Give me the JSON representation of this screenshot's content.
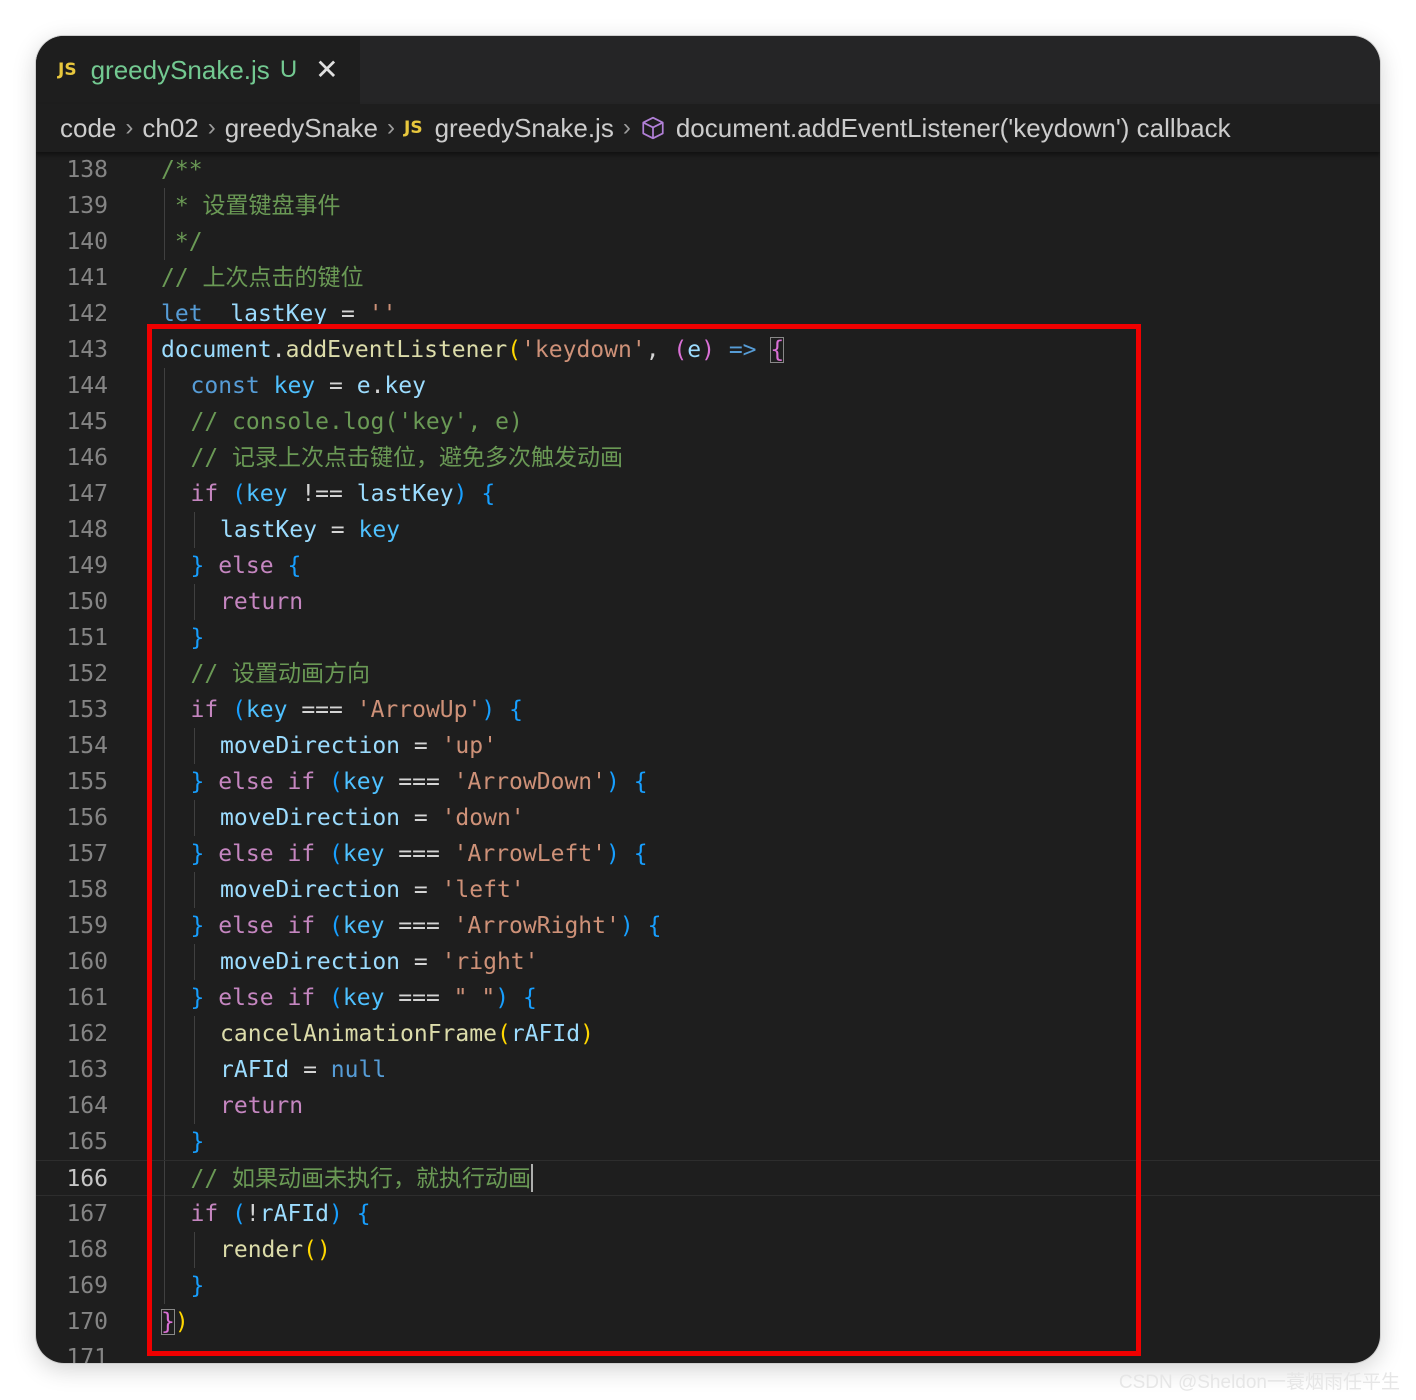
{
  "tab": {
    "badge": "JS",
    "filename": "greedySnake.js",
    "status": "U",
    "close": "✕"
  },
  "breadcrumb": {
    "items": [
      "code",
      "ch02",
      "greedySnake",
      "greedySnake.js",
      "document.addEventListener('keydown') callback"
    ],
    "separator": "›",
    "file_badge": "JS"
  },
  "editor": {
    "current_line": 166,
    "lines": [
      {
        "n": "138",
        "indent": 0,
        "tokens": [
          [
            "cmt",
            "/**"
          ]
        ]
      },
      {
        "n": "139",
        "indent": 0,
        "tokens": [
          [
            "cmt",
            " * 设置键盘事件"
          ]
        ]
      },
      {
        "n": "140",
        "indent": 0,
        "tokens": [
          [
            "cmt",
            " */"
          ]
        ]
      },
      {
        "n": "141",
        "indent": 0,
        "tokens": [
          [
            "cmt",
            "// 上次点击的键位"
          ]
        ]
      },
      {
        "n": "142",
        "indent": 0,
        "tokens": [
          [
            "kw",
            "let"
          ],
          [
            "",
            "  "
          ],
          [
            "var",
            "lastKey"
          ],
          [
            "",
            " = "
          ],
          [
            "str",
            "''"
          ]
        ]
      },
      {
        "n": "143",
        "indent": 0,
        "tokens": [
          [
            "var",
            "document"
          ],
          [
            "",
            "."
          ],
          [
            "fn",
            "addEventListener"
          ],
          [
            "p1",
            "("
          ],
          [
            "str",
            "'keydown'"
          ],
          [
            "",
            ", "
          ],
          [
            "p2",
            "("
          ],
          [
            "var",
            "e"
          ],
          [
            "p2",
            ")"
          ],
          [
            "",
            " "
          ],
          [
            "kw",
            "=>"
          ],
          [
            "",
            " "
          ],
          [
            "p2 bm",
            "{"
          ]
        ]
      },
      {
        "n": "144",
        "indent": 1,
        "tokens": [
          [
            "kw",
            "const"
          ],
          [
            "",
            " "
          ],
          [
            "const",
            "key"
          ],
          [
            "",
            " = "
          ],
          [
            "var",
            "e"
          ],
          [
            "",
            "."
          ],
          [
            "var",
            "key"
          ]
        ]
      },
      {
        "n": "145",
        "indent": 1,
        "tokens": [
          [
            "cmt",
            "// console.log('key', e)"
          ]
        ]
      },
      {
        "n": "146",
        "indent": 1,
        "tokens": [
          [
            "cmt",
            "// 记录上次点击键位，避免多次触发动画"
          ]
        ]
      },
      {
        "n": "147",
        "indent": 1,
        "tokens": [
          [
            "ctl",
            "if"
          ],
          [
            "",
            " "
          ],
          [
            "p3",
            "("
          ],
          [
            "const",
            "key"
          ],
          [
            "",
            " !== "
          ],
          [
            "var",
            "lastKey"
          ],
          [
            "p3",
            ")"
          ],
          [
            "",
            " "
          ],
          [
            "p3",
            "{"
          ]
        ]
      },
      {
        "n": "148",
        "indent": 2,
        "tokens": [
          [
            "var",
            "lastKey"
          ],
          [
            "",
            " = "
          ],
          [
            "const",
            "key"
          ]
        ]
      },
      {
        "n": "149",
        "indent": 1,
        "tokens": [
          [
            "p3",
            "}"
          ],
          [
            "",
            " "
          ],
          [
            "ctl",
            "else"
          ],
          [
            "",
            " "
          ],
          [
            "p3",
            "{"
          ]
        ]
      },
      {
        "n": "150",
        "indent": 2,
        "tokens": [
          [
            "ctl",
            "return"
          ]
        ]
      },
      {
        "n": "151",
        "indent": 1,
        "tokens": [
          [
            "p3",
            "}"
          ]
        ]
      },
      {
        "n": "152",
        "indent": 1,
        "tokens": [
          [
            "cmt",
            "// 设置动画方向"
          ]
        ]
      },
      {
        "n": "153",
        "indent": 1,
        "tokens": [
          [
            "ctl",
            "if"
          ],
          [
            "",
            " "
          ],
          [
            "p3",
            "("
          ],
          [
            "const",
            "key"
          ],
          [
            "",
            " === "
          ],
          [
            "str",
            "'ArrowUp'"
          ],
          [
            "p3",
            ")"
          ],
          [
            "",
            " "
          ],
          [
            "p3",
            "{"
          ]
        ]
      },
      {
        "n": "154",
        "indent": 2,
        "tokens": [
          [
            "var",
            "moveDirection"
          ],
          [
            "",
            " = "
          ],
          [
            "str",
            "'up'"
          ]
        ]
      },
      {
        "n": "155",
        "indent": 1,
        "tokens": [
          [
            "p3",
            "}"
          ],
          [
            "",
            " "
          ],
          [
            "ctl",
            "else if"
          ],
          [
            "",
            " "
          ],
          [
            "p3",
            "("
          ],
          [
            "const",
            "key"
          ],
          [
            "",
            " === "
          ],
          [
            "str",
            "'ArrowDown'"
          ],
          [
            "p3",
            ")"
          ],
          [
            "",
            " "
          ],
          [
            "p3",
            "{"
          ]
        ]
      },
      {
        "n": "156",
        "indent": 2,
        "tokens": [
          [
            "var",
            "moveDirection"
          ],
          [
            "",
            " = "
          ],
          [
            "str",
            "'down'"
          ]
        ]
      },
      {
        "n": "157",
        "indent": 1,
        "tokens": [
          [
            "p3",
            "}"
          ],
          [
            "",
            " "
          ],
          [
            "ctl",
            "else if"
          ],
          [
            "",
            " "
          ],
          [
            "p3",
            "("
          ],
          [
            "const",
            "key"
          ],
          [
            "",
            " === "
          ],
          [
            "str",
            "'ArrowLeft'"
          ],
          [
            "p3",
            ")"
          ],
          [
            "",
            " "
          ],
          [
            "p3",
            "{"
          ]
        ]
      },
      {
        "n": "158",
        "indent": 2,
        "tokens": [
          [
            "var",
            "moveDirection"
          ],
          [
            "",
            " = "
          ],
          [
            "str",
            "'left'"
          ]
        ]
      },
      {
        "n": "159",
        "indent": 1,
        "tokens": [
          [
            "p3",
            "}"
          ],
          [
            "",
            " "
          ],
          [
            "ctl",
            "else if"
          ],
          [
            "",
            " "
          ],
          [
            "p3",
            "("
          ],
          [
            "const",
            "key"
          ],
          [
            "",
            " === "
          ],
          [
            "str",
            "'ArrowRight'"
          ],
          [
            "p3",
            ")"
          ],
          [
            "",
            " "
          ],
          [
            "p3",
            "{"
          ]
        ]
      },
      {
        "n": "160",
        "indent": 2,
        "tokens": [
          [
            "var",
            "moveDirection"
          ],
          [
            "",
            " = "
          ],
          [
            "str",
            "'right'"
          ]
        ]
      },
      {
        "n": "161",
        "indent": 1,
        "tokens": [
          [
            "p3",
            "}"
          ],
          [
            "",
            " "
          ],
          [
            "ctl",
            "else if"
          ],
          [
            "",
            " "
          ],
          [
            "p3",
            "("
          ],
          [
            "const",
            "key"
          ],
          [
            "",
            " === "
          ],
          [
            "str",
            "\" \""
          ],
          [
            "p3",
            ")"
          ],
          [
            "",
            " "
          ],
          [
            "p3",
            "{"
          ]
        ]
      },
      {
        "n": "162",
        "indent": 2,
        "tokens": [
          [
            "fn",
            "cancelAnimationFrame"
          ],
          [
            "p1",
            "("
          ],
          [
            "var",
            "rAFId"
          ],
          [
            "p1",
            ")"
          ]
        ]
      },
      {
        "n": "163",
        "indent": 2,
        "tokens": [
          [
            "var",
            "rAFId"
          ],
          [
            "",
            " = "
          ],
          [
            "kw",
            "null"
          ]
        ]
      },
      {
        "n": "164",
        "indent": 2,
        "tokens": [
          [
            "ctl",
            "return"
          ]
        ]
      },
      {
        "n": "165",
        "indent": 1,
        "tokens": [
          [
            "p3",
            "}"
          ]
        ]
      },
      {
        "n": "166",
        "indent": 1,
        "tokens": [
          [
            "cmt",
            "// 如果动画未执行，就执行动画"
          ],
          [
            "caret",
            ""
          ]
        ]
      },
      {
        "n": "167",
        "indent": 1,
        "tokens": [
          [
            "ctl",
            "if"
          ],
          [
            "",
            " "
          ],
          [
            "p3",
            "("
          ],
          [
            "",
            "!"
          ],
          [
            "var",
            "rAFId"
          ],
          [
            "p3",
            ")"
          ],
          [
            "",
            " "
          ],
          [
            "p3",
            "{"
          ]
        ]
      },
      {
        "n": "168",
        "indent": 2,
        "tokens": [
          [
            "fn",
            "render"
          ],
          [
            "p1",
            "()"
          ]
        ]
      },
      {
        "n": "169",
        "indent": 1,
        "tokens": [
          [
            "p3",
            "}"
          ]
        ]
      },
      {
        "n": "170",
        "indent": 0,
        "tokens": [
          [
            "p2 bm",
            "}"
          ],
          [
            "p1",
            ")"
          ]
        ]
      },
      {
        "n": "171",
        "indent": 0,
        "tokens": []
      }
    ]
  },
  "watermark": "CSDN @Sheldon一蓑烟雨任平生",
  "colors": {
    "highlight_box": "#f00000",
    "editor_bg": "#1e1e1e",
    "tab_modified": "#73c991",
    "js_badge": "#e8c73d"
  }
}
